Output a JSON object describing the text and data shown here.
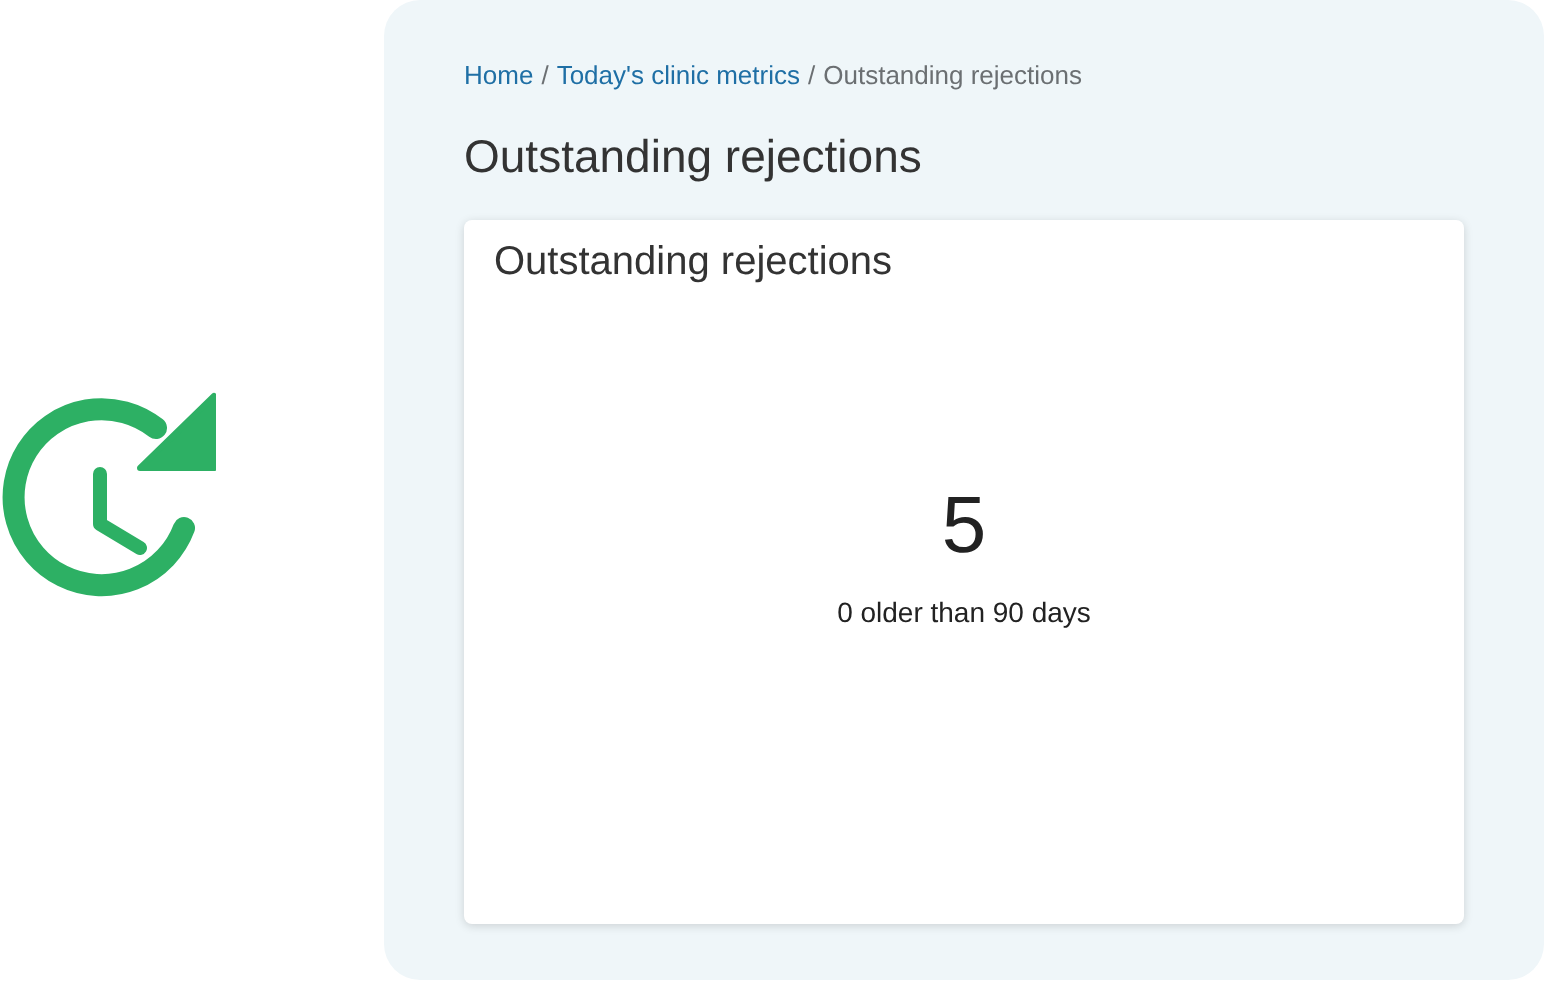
{
  "breadcrumb": {
    "separator": "/",
    "items": [
      {
        "label": "Home",
        "kind": "link"
      },
      {
        "label": "Today's clinic metrics",
        "kind": "link"
      },
      {
        "label": "Outstanding rejections",
        "kind": "current"
      }
    ]
  },
  "page_title": "Outstanding rejections",
  "card": {
    "title": "Outstanding rejections",
    "value": "5",
    "caption": "0 older than 90 days"
  }
}
